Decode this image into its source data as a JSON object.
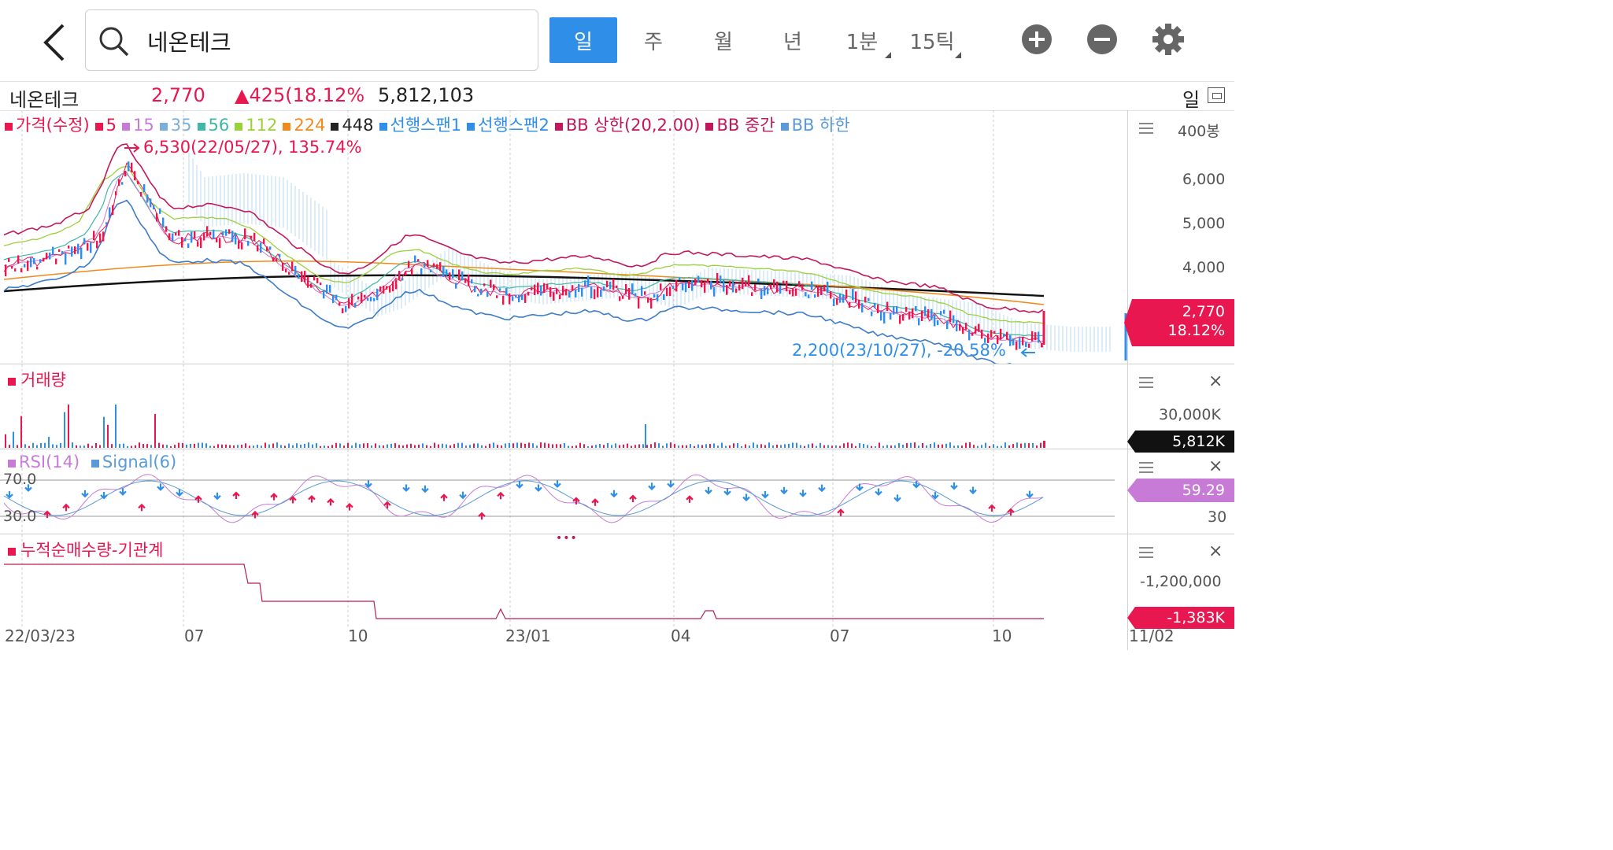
{
  "search": {
    "query": "네온테크"
  },
  "periods": [
    {
      "label": "일",
      "active": true
    },
    {
      "label": "주"
    },
    {
      "label": "월"
    },
    {
      "label": "년"
    },
    {
      "label": "1분"
    },
    {
      "label": "15틱"
    }
  ],
  "info": {
    "name": "네온테크",
    "price": "2,770",
    "change": "▲425(18.12%",
    "volume": "5,812,103",
    "period": "일"
  },
  "price_panel": {
    "legend": [
      {
        "label": "가격(수정)",
        "color": "#e8174f"
      },
      {
        "label": "5",
        "color": "#e8174f"
      },
      {
        "label": "15",
        "color": "#c77bd6"
      },
      {
        "label": "35",
        "color": "#7aaedb"
      },
      {
        "label": "56",
        "color": "#3fb6a6"
      },
      {
        "label": "112",
        "color": "#9ad13b"
      },
      {
        "label": "224",
        "color": "#f08a1d"
      },
      {
        "label": "448",
        "color": "#222222"
      },
      {
        "label": "선행스팬1",
        "color": "#2f8ee8"
      },
      {
        "label": "선행스팬2",
        "color": "#2f8ee8"
      },
      {
        "label": "BB 상한(20,2.00)",
        "color": "#c2185b"
      },
      {
        "label": "BB 중간",
        "color": "#c2185b"
      },
      {
        "label": "BB 하한",
        "color": "#5a9ad6"
      }
    ],
    "axis_unit": "400봉",
    "y_ticks": [
      "6,000",
      "5,000",
      "4,000"
    ],
    "high_label": "6,530(22/05/27), 135.74%",
    "low_label": "2,200(23/10/27), -20.58%",
    "price_tag": "2,770",
    "pct_tag": "18.12%"
  },
  "volume_panel": {
    "title": "거래량",
    "y_tick": "30,000K",
    "tag": "5,812K"
  },
  "rsi_panel": {
    "legend": [
      {
        "label": "RSI(14)",
        "color": "#c77bd6"
      },
      {
        "label": "Signal(6)",
        "color": "#5a9ad6"
      }
    ],
    "upper": "70.0",
    "lower": "30.0",
    "tag": "59.29",
    "axis_right": "30",
    "more": "•••"
  },
  "net_panel": {
    "title": "누적순매수량-기관계",
    "y_tick": "-1,200,000",
    "tag": "-1,383K"
  },
  "x_axis": [
    "22/03/23",
    "07",
    "10",
    "23/01",
    "04",
    "07",
    "10",
    "11/02"
  ],
  "colors": {
    "up": "#e8174f",
    "down": "#2f8ee8",
    "accent": "#2f8ee8",
    "rsi_tag": "#c77bd6",
    "vol_tag": "#111111"
  }
}
